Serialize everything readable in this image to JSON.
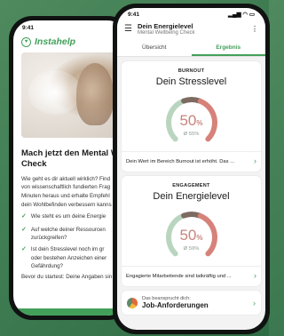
{
  "back_screen": {
    "status_time": "9:41",
    "brand": "Instahelp",
    "heading": "Mach jetzt den Mental W",
    "heading2": "Check",
    "intro_lines": [
      "Wie geht es dir aktuell wirklich? Find",
      "von wissenschaftlich fundierten Frag",
      "Minuten heraus und erhalte Empfehl",
      "dein Wohlbefinden verbessern kanns"
    ],
    "checklist": [
      {
        "l1": "Wie steht es um deine Energie",
        "l2": ""
      },
      {
        "l1": "Auf welche deiner Ressourcen",
        "l2": "zurückgreifen?"
      },
      {
        "l1": "Ist dein Stresslevel noch im gr",
        "l2": "oder bestehen Anzeichen einer",
        "l3": "Gefährdung?"
      }
    ],
    "footer_text": "Bevor du startest: Deine Angaben sin"
  },
  "front_screen": {
    "status_time": "9:41",
    "header_title": "Dein Energielevel",
    "header_subtitle": "Mental Wellbeing Check",
    "tabs": [
      {
        "label": "Übersicht",
        "active": false
      },
      {
        "label": "Ergebnis",
        "active": true
      }
    ],
    "cards": [
      {
        "kicker": "BURNOUT",
        "title": "Dein Stresslevel",
        "value": "50",
        "value_unit": "%",
        "average": "Ø 55%",
        "level": 0.5,
        "description": "Dein Wert im Bereich Burnout ist erhöht. Das ..."
      },
      {
        "kicker": "ENGAGEMENT",
        "title": "Dein Energielevel",
        "value": "50",
        "value_unit": "%",
        "average": "Ø 59%",
        "level": 0.5,
        "description": "Engagierte Mitarbeitende sind tatkräftig und ..."
      }
    ],
    "mini_card": {
      "label": "Das beansprucht dich:",
      "title": "Job-Anforderungen"
    }
  },
  "colors": {
    "accent": "#43a05a",
    "gauge_red": "#d6827a",
    "gauge_green": "#b9d5bf",
    "gauge_brown": "#7d6a60"
  }
}
